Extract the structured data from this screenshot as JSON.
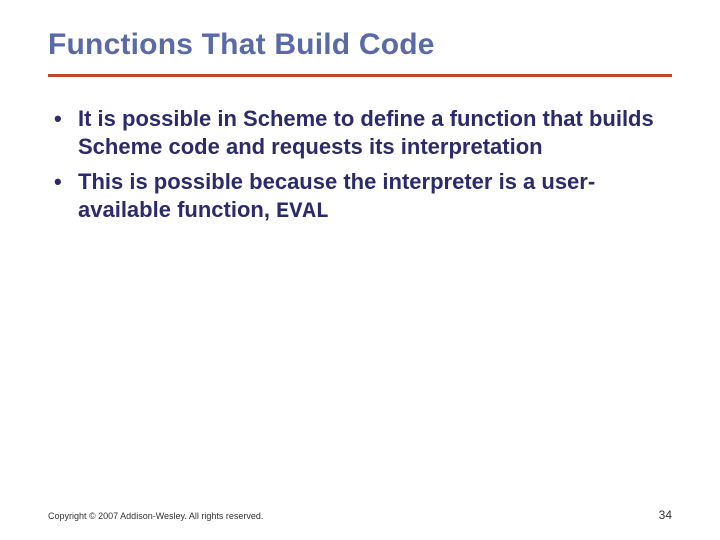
{
  "title": "Functions That Build Code",
  "bullets": [
    {
      "text": "It is possible in Scheme to define a function that builds Scheme code and requests its interpretation",
      "code": ""
    },
    {
      "text": "This is possible because the interpreter is a user-available function, ",
      "code": "EVAL"
    }
  ],
  "footer": {
    "copyright": "Copyright © 2007 Addison-Wesley. All rights reserved.",
    "page": "34"
  }
}
